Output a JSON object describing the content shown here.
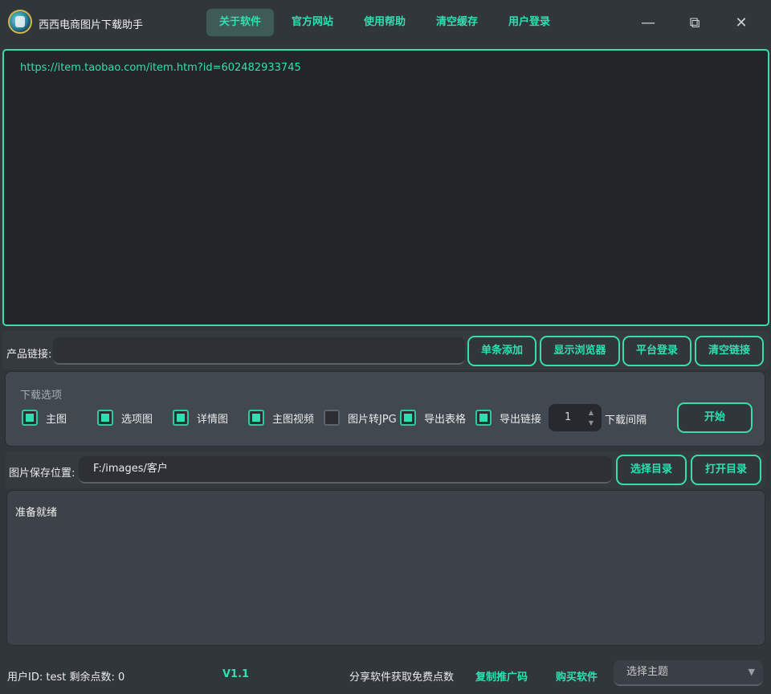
{
  "app": {
    "title": "西西电商图片下载助手"
  },
  "nav": [
    {
      "label": "关于软件",
      "active": true
    },
    {
      "label": "官方网站"
    },
    {
      "label": "使用帮助"
    },
    {
      "label": "清空缓存"
    },
    {
      "label": "用户登录"
    }
  ],
  "window_controls": {
    "minimize": "—",
    "restore": "⧉",
    "close": "✕"
  },
  "url_list": {
    "text": "https://item.taobao.com/item.htm?id=602482933745"
  },
  "product_link": {
    "label": "产品链接:",
    "value": ""
  },
  "row_buttons": {
    "add_single": "单条添加",
    "show_browser": "显示浏览器",
    "platform_login": "平台登录",
    "clear_links": "清空链接"
  },
  "options": {
    "title": "下载选项",
    "items": [
      {
        "label": "主图",
        "checked": true
      },
      {
        "label": "选项图",
        "checked": true
      },
      {
        "label": "详情图",
        "checked": true
      },
      {
        "label": "主图视频",
        "checked": true
      },
      {
        "label": "图片转JPG",
        "checked": false
      },
      {
        "label": "导出表格",
        "checked": true
      },
      {
        "label": "导出链接",
        "checked": true
      }
    ],
    "interval_value": "1",
    "interval_label": "下载间隔",
    "spin_up": "▲",
    "spin_down": "▼",
    "start_label": "开始"
  },
  "save": {
    "label": "图片保存位置:",
    "path": "F:/images/客户",
    "choose_dir": "选择目录",
    "open_dir": "打开目录"
  },
  "log": {
    "text": "准备就绪"
  },
  "footer": {
    "user_info": "用户ID: test 剩余点数: 0",
    "version": "V1.1",
    "share_text": "分享软件获取免费点数",
    "copy_code": "复制推广码",
    "buy": "购买软件",
    "theme_placeholder": "选择主题",
    "theme_arrow": "▼"
  },
  "colors": {
    "accent": "#2ee0b0",
    "background": "#31363b"
  }
}
